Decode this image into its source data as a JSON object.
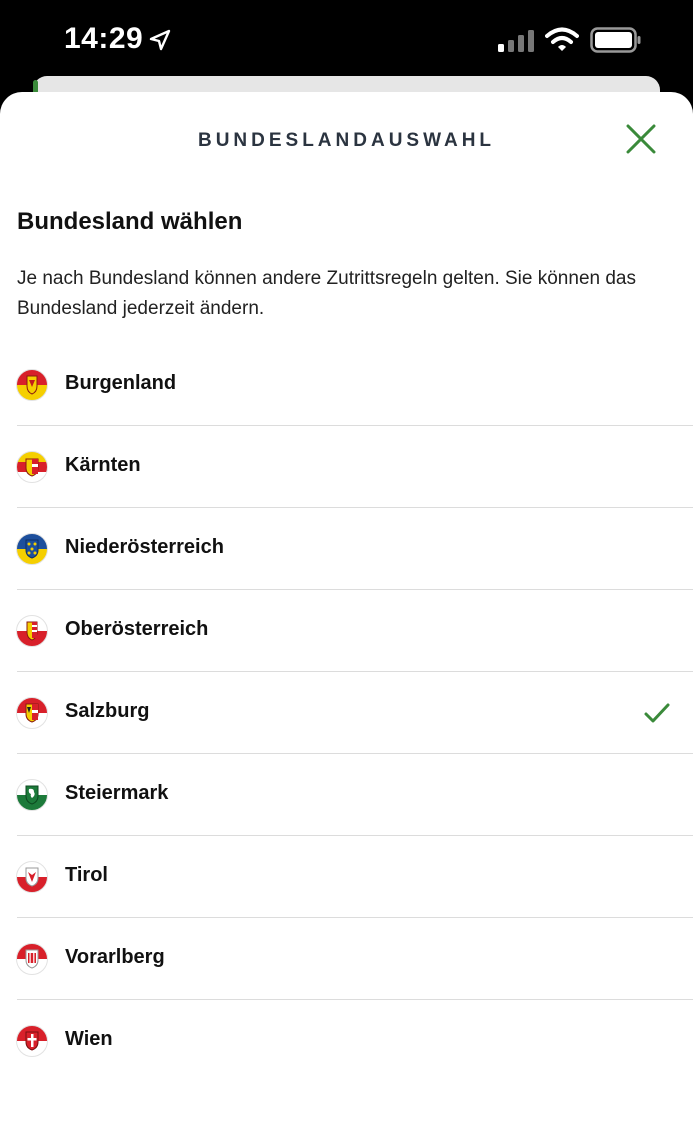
{
  "status_bar": {
    "time": "14:29"
  },
  "sheet": {
    "title": "BUNDESLANDAUSWAHL",
    "close_icon": "close-icon",
    "heading": "Bundesland wählen",
    "description": "Je nach Bundesland können andere Zutrittsregeln gelten. Sie können das Bundesland jederzeit ändern.",
    "accent_color": "#3a8a3a",
    "selected": "Salzburg"
  },
  "states": [
    {
      "label": "Burgenland",
      "colors": [
        "#d8202a",
        "#f5cf00"
      ],
      "selected": false
    },
    {
      "label": "Kärnten",
      "colors": [
        "#f5cf00",
        "#d8202a",
        "#ffffff"
      ],
      "selected": false
    },
    {
      "label": "Niederösterreich",
      "colors": [
        "#1d4f9c",
        "#f5cf00"
      ],
      "selected": false
    },
    {
      "label": "Oberösterreich",
      "colors": [
        "#ffffff",
        "#d8202a"
      ],
      "selected": false
    },
    {
      "label": "Salzburg",
      "colors": [
        "#d8202a",
        "#ffffff"
      ],
      "selected": true
    },
    {
      "label": "Steiermark",
      "colors": [
        "#ffffff",
        "#1c7a3a"
      ],
      "selected": false
    },
    {
      "label": "Tirol",
      "colors": [
        "#ffffff",
        "#d8202a"
      ],
      "selected": false
    },
    {
      "label": "Vorarlberg",
      "colors": [
        "#d8202a",
        "#ffffff"
      ],
      "selected": false
    },
    {
      "label": "Wien",
      "colors": [
        "#d8202a",
        "#ffffff"
      ],
      "selected": false
    }
  ]
}
